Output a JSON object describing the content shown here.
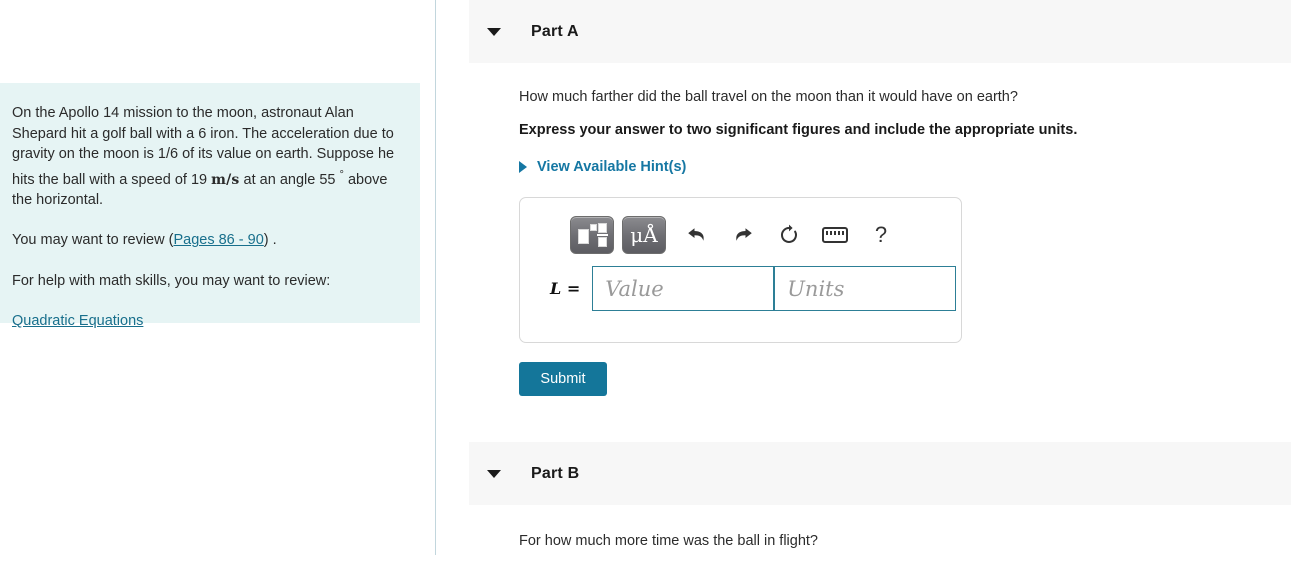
{
  "header": {
    "book_icon": "book-icon"
  },
  "problem": {
    "paragraph1_pre": "On the Apollo 14 mission to the moon, astronaut Alan Shepard hit a golf ball with a 6 iron. The acceleration due to gravity on the moon is 1/6 of its value on earth. Suppose he hits the ball with a speed of 19 ",
    "speed_units": "m/s",
    "paragraph1_mid": " at an angle 55 ",
    "degree_symbol": "°",
    "paragraph1_post": " above the horizontal.",
    "review_prefix": "You may want to review (",
    "review_link": "Pages 86 - 90",
    "review_suffix": ") .",
    "math_help_text": "For help with math skills, you may want to review:",
    "math_help_link": "Quadratic Equations"
  },
  "part_a": {
    "title": "Part A",
    "question": "How much farther did the ball travel on the moon than it would have on earth?",
    "instruction": "Express your answer to two significant figures and include the appropriate units.",
    "hints_label": "View Available Hint(s)",
    "toolbar": {
      "template_button": "math-template-button",
      "units_button_label": "μÅ",
      "undo": "undo-icon",
      "redo": "redo-icon",
      "reset": "reset-icon",
      "keyboard": "keyboard-icon",
      "help_label": "?"
    },
    "answer": {
      "label_variable": "L",
      "label_equals": "=",
      "value_placeholder": "Value",
      "value_text": "",
      "units_placeholder": "Units",
      "units_text": ""
    },
    "submit_label": "Submit"
  },
  "part_b": {
    "title": "Part B",
    "question": "For how much more time was the ball in flight?"
  },
  "colors": {
    "accent_teal": "#14769a",
    "link_blue": "#1577a3",
    "panel_bg": "#e6f4f4",
    "header_bg": "#f7f7f7",
    "input_border": "#2d7f96"
  }
}
